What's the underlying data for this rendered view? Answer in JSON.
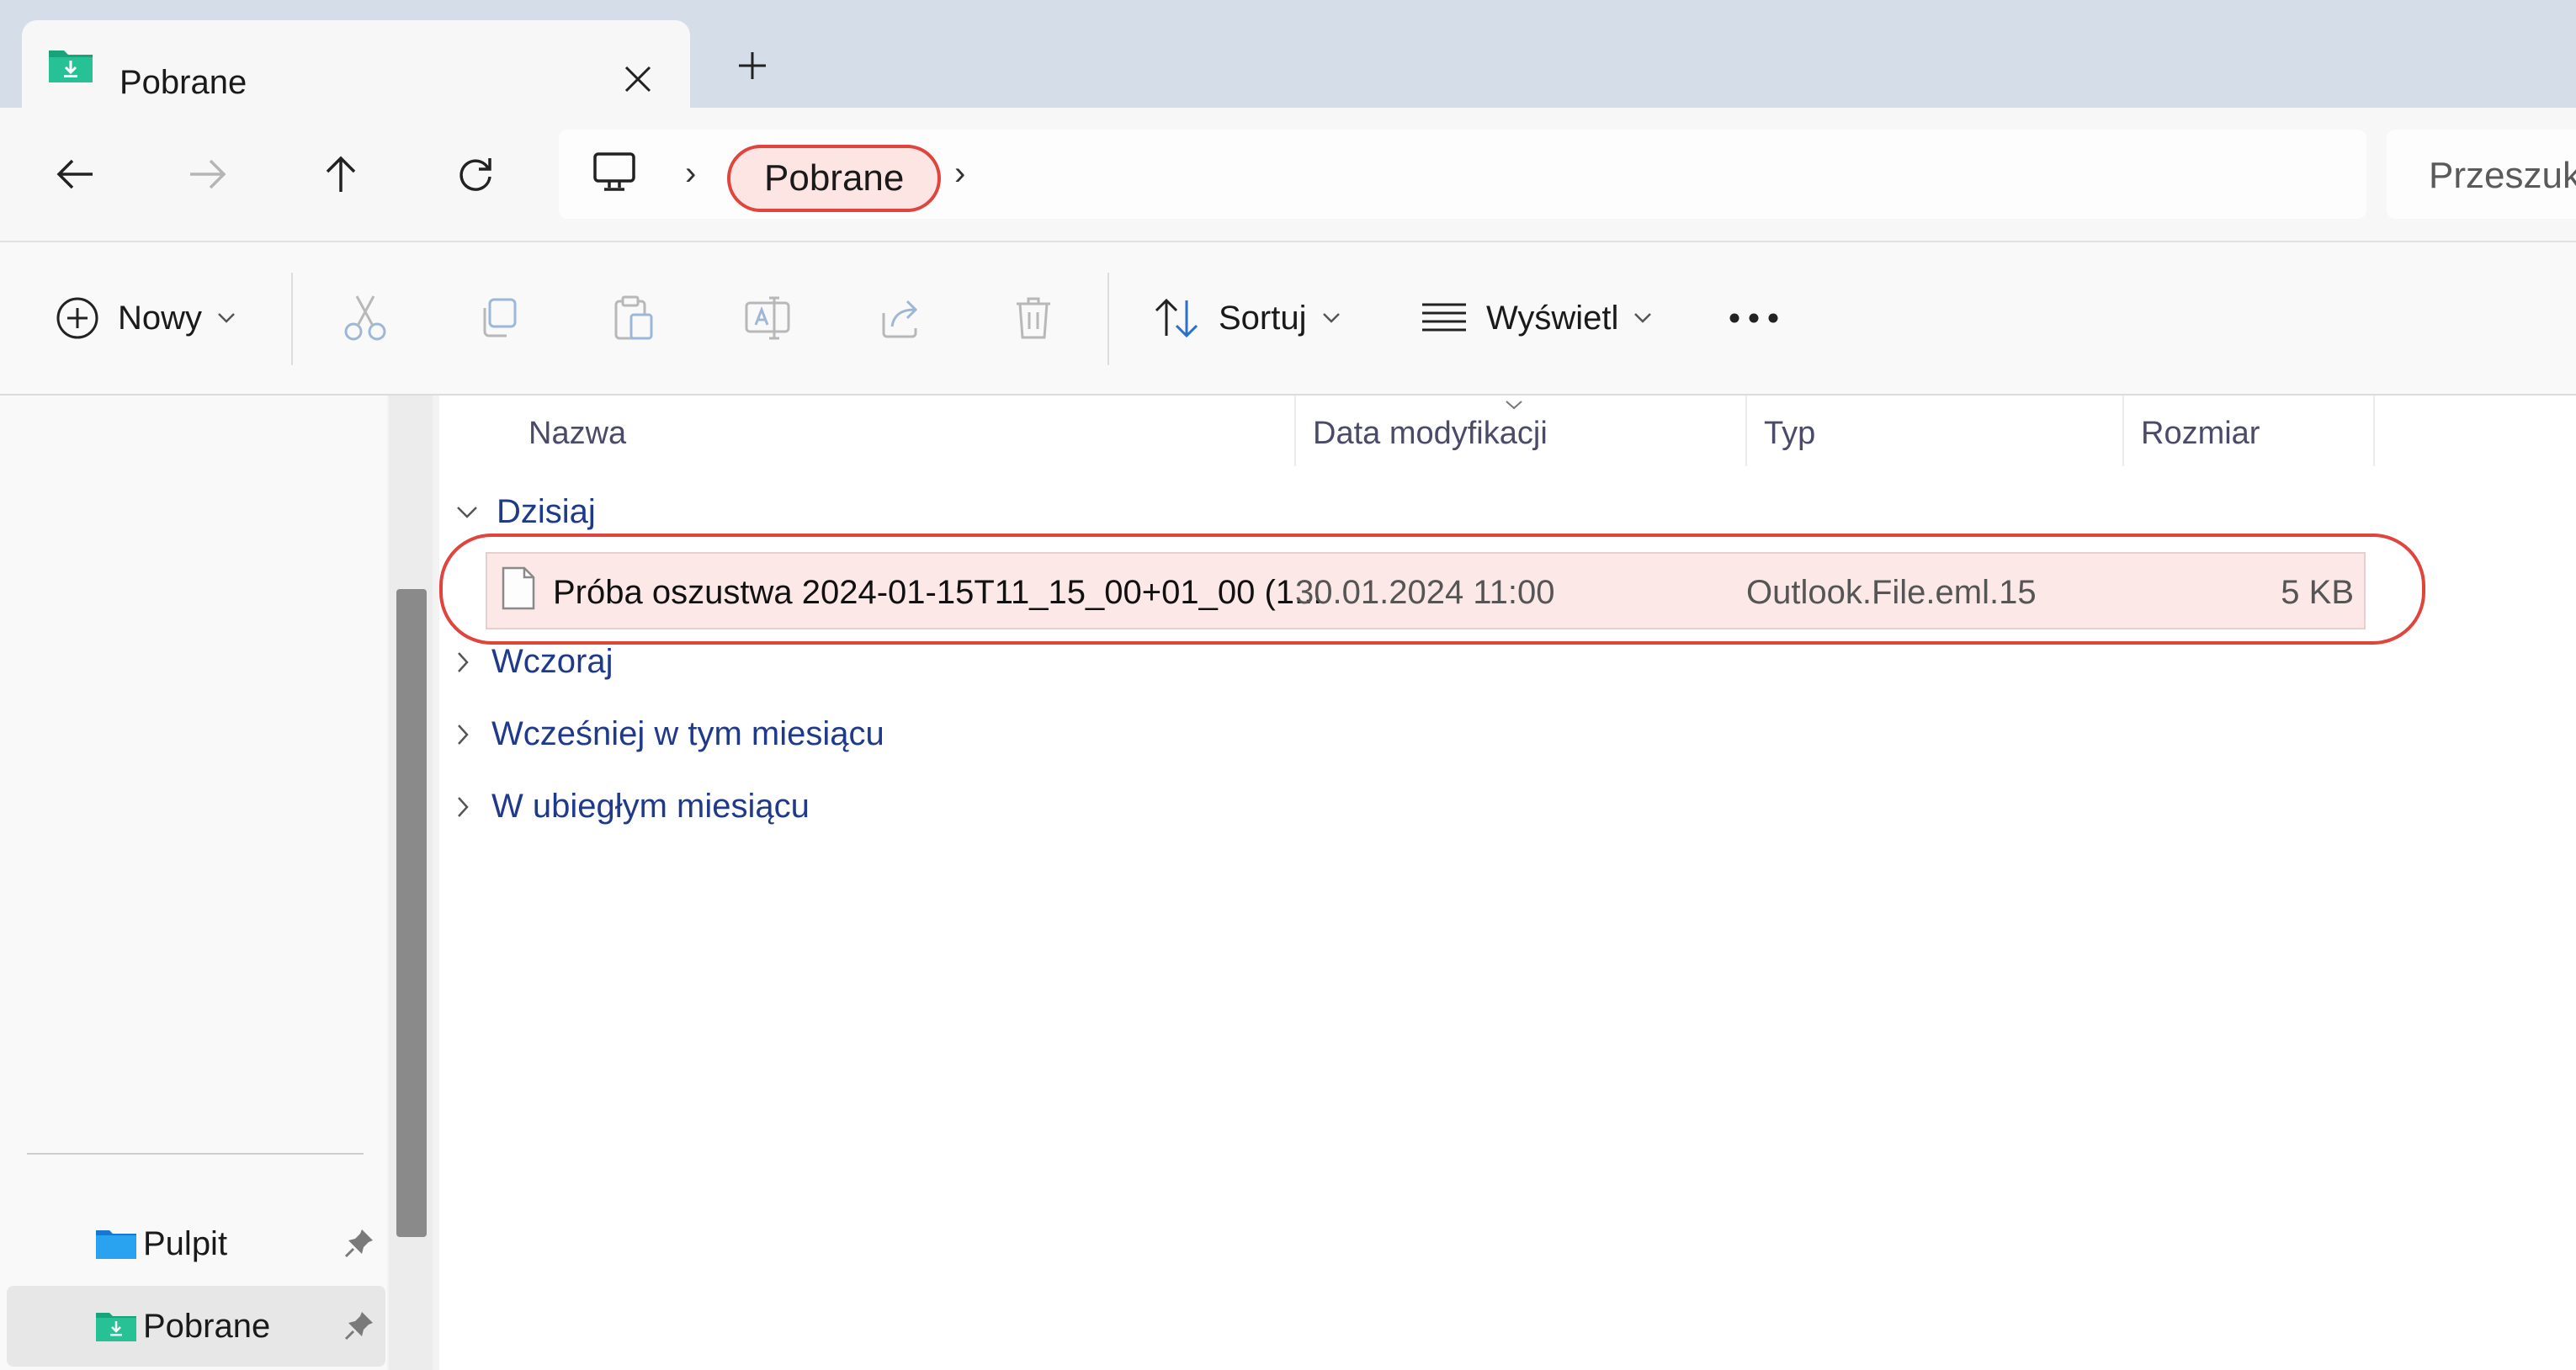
{
  "tab": {
    "title": "Pobrane",
    "icon": "downloads-folder-icon"
  },
  "address": {
    "current": "Pobrane",
    "separator": "›",
    "search_placeholder": "Przeszukaj"
  },
  "toolbar": {
    "new_label": "Nowy",
    "sort_label": "Sortuj",
    "view_label": "Wyświetl"
  },
  "columns": {
    "name": "Nazwa",
    "modified": "Data modyfikacji",
    "type": "Typ",
    "size": "Rozmiar"
  },
  "groups": {
    "today": "Dzisiaj",
    "yesterday": "Wczoraj",
    "earlier_month": "Wcześniej w tym miesiącu",
    "last_month": "W ubiegłym miesiącu"
  },
  "file": {
    "name": "Próba oszustwa 2024-01-15T11_15_00+01_00 (1...",
    "modified": "30.01.2024 11:00",
    "type": "Outlook.File.eml.15",
    "size": "5 KB"
  },
  "sidebar": {
    "items": [
      {
        "label": "Pulpit"
      },
      {
        "label": "Pobrane"
      }
    ]
  },
  "colors": {
    "highlight_border": "#e0443c",
    "highlight_fill": "#fde5e3",
    "group_text": "#1f3a8a"
  }
}
